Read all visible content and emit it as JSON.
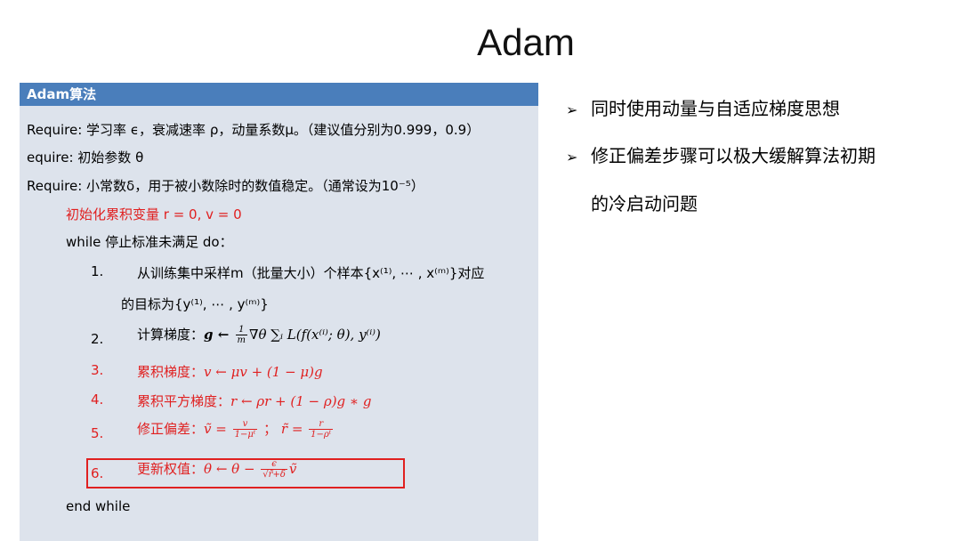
{
  "slide": {
    "title": "Adam"
  },
  "algorithm": {
    "header": "Adam算法",
    "require1": "Require: 学习率 ϵ，衰减速率 ρ，动量系数μ。（建议值分别为0.999，0.9）",
    "require2": "equire: 初始参数 θ",
    "require3": "Require: 小常数δ，用于被小数除时的数值稳定。（通常设为10⁻⁵）",
    "init": "初始化累积变量  r = 0, v = 0",
    "while": "while 停止标准未满足 do：",
    "step1_num": "1.",
    "step1_text": "从训练集中采样m（批量大小）个样本{x⁽¹⁾, ⋯ , x⁽ᵐ⁾}对应",
    "step1_cont": "的目标为{y⁽¹⁾, ⋯ , y⁽ᵐ⁾}",
    "step2_num": "2.",
    "step2_label": "计算梯度：",
    "step2_formula": "g ← ",
    "step2_frac_n": "1",
    "step2_frac_d": "m",
    "step2_rest": "∇θ ∑ᵢ L(f(x⁽ⁱ⁾; θ), y⁽ⁱ⁾)",
    "step3_num": "3.",
    "step3_text": "累积梯度：",
    "step3_formula": "v ← μv + (1 − μ)g",
    "step4_num": "4.",
    "step4_text": "累积平方梯度：",
    "step4_formula": "r ← ρr + (1 − ρ)g ∗ g",
    "step5_num": "5.",
    "step5_text": "修正偏差：",
    "step5_v": "ṽ = ",
    "step5_v_n": "v",
    "step5_v_d": "1−μᵗ",
    "step5_sep": " ；",
    "step5_r": "r̃ = ",
    "step5_r_n": "r",
    "step5_r_d": "1−ρᵗ",
    "step6_num": "6.",
    "step6_text": "更新权值：",
    "step6_formula": "θ ← θ − ",
    "step6_n": "ϵ",
    "step6_d": "√r̃+δ",
    "step6_end": "ṽ",
    "end": "end while"
  },
  "bullets": [
    "同时使用动量与自适应梯度思想",
    "修正偏差步骤可以极大缓解算法初期",
    "的冷启动问题"
  ],
  "bullet_marker": "➢",
  "colors": {
    "header_bg": "#4a7ebb",
    "box_bg": "#dde3ec",
    "highlight": "#e02020"
  }
}
